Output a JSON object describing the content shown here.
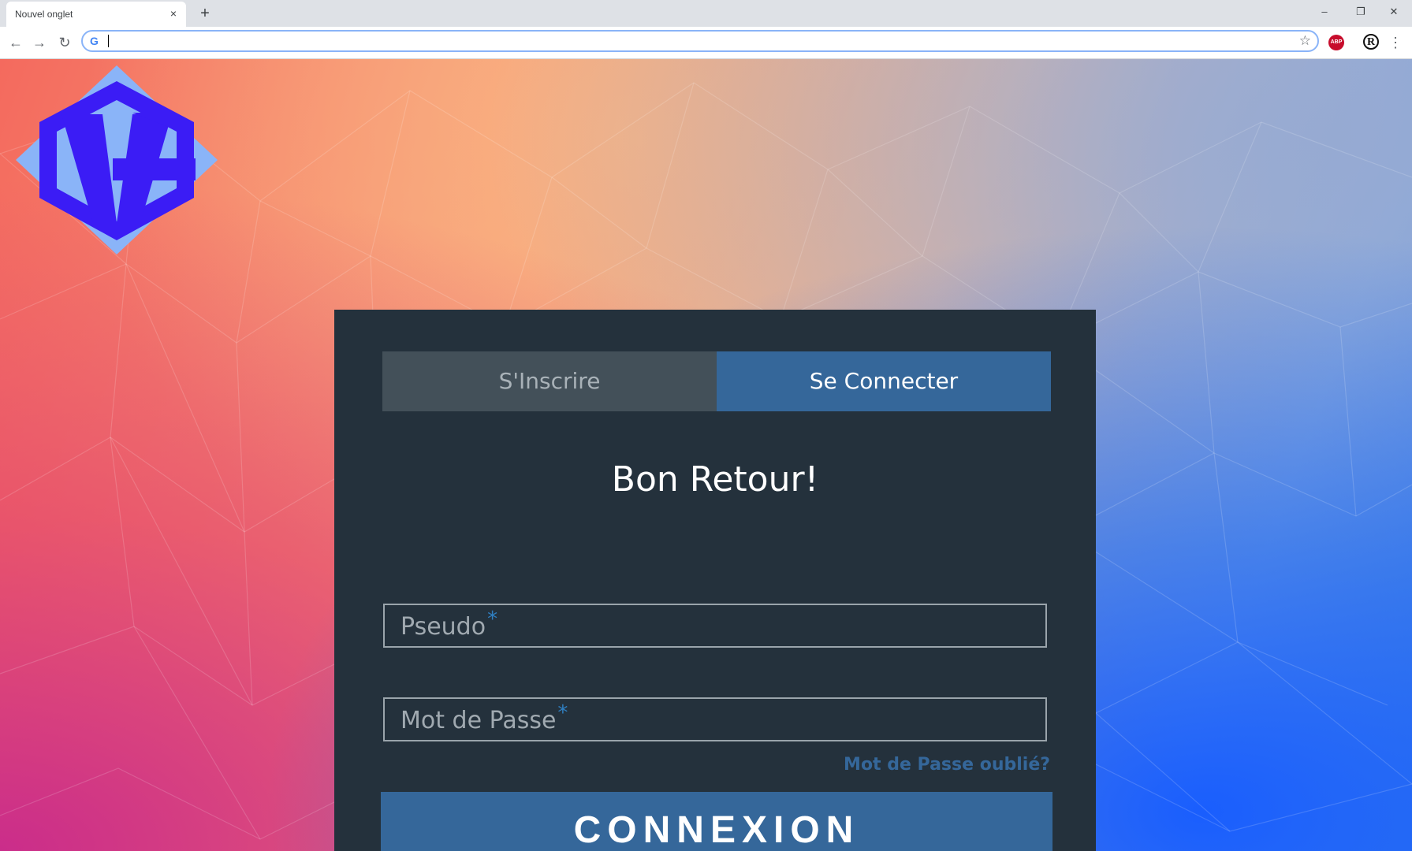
{
  "browser": {
    "tab_title": "Nouvel onglet",
    "tab_close": "×",
    "new_tab": "+",
    "address_value": "",
    "window_controls": {
      "minimize": "–",
      "restore": "❐",
      "close": "✕"
    },
    "extensions": {
      "abp": "ABP",
      "r": "R"
    }
  },
  "icons": {
    "back": "back-arrow-icon",
    "forward": "forward-arrow-icon",
    "reload": "reload-icon",
    "google": "google-g-icon",
    "bookmark": "star-icon",
    "menu": "kebab-menu-icon",
    "logo": "g-hexagon-logo"
  },
  "login": {
    "tabs": {
      "signup": "S'Inscrire",
      "login": "Se Connecter"
    },
    "heading": "Bon Retour!",
    "pseudo_label": "Pseudo",
    "password_label": "Mot de Passe",
    "required_mark": "*",
    "forgot_link": "Mot de Passe oublié?",
    "submit_label": "CONNEXION"
  },
  "colors": {
    "card_bg": "#24313c",
    "accent": "#35679a",
    "inactive_tab": "#435059",
    "logo_outer": "#8ab4f8",
    "logo_inner": "#3b1cf5"
  }
}
